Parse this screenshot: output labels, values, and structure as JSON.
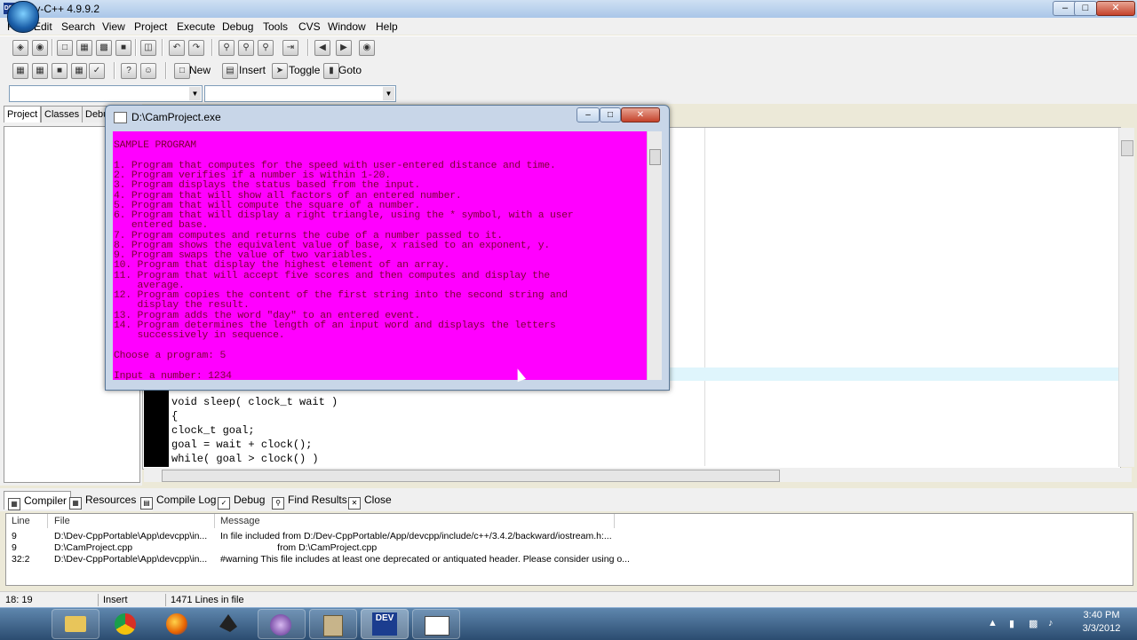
{
  "app": {
    "title": "Dev-C++ 4.9.9.2",
    "icon_label": "DEV"
  },
  "menu": [
    "File",
    "Edit",
    "Search",
    "View",
    "Project",
    "Execute",
    "Debug",
    "Tools",
    "CVS",
    "Window",
    "Help"
  ],
  "toolbar2": {
    "new_label": "New",
    "insert_label": "Insert",
    "toggle_label": "Toggle",
    "goto_label": "Goto"
  },
  "left_tabs": [
    "Project",
    "Classes",
    "Debu"
  ],
  "console": {
    "title": "D:\\CamProject.exe",
    "lines": [
      "SAMPLE PROGRAM",
      "",
      "1. Program that computes for the speed with user-entered distance and time.",
      "2. Program verifies if a number is within 1-20.",
      "3. Program displays the status based from the input.",
      "4. Program that will show all factors of an entered number.",
      "5. Program that will compute the square of a number.",
      "6. Program that will display a right triangle, using the * symbol, with a user",
      "   entered base.",
      "7. Program computes and returns the cube of a number passed to it.",
      "8. Program shows the equivalent value of base, x raised to an exponent, y.",
      "9. Program swaps the value of two variables.",
      "10. Program that display the highest element of an array.",
      "11. Program that will accept five scores and then computes and display the",
      "    average.",
      "12. Program copies the content of the first string into the second string and",
      "    display the result.",
      "13. Program adds the word \"day\" to an entered event.",
      "14. Program determines the length of an input word and displays the letters",
      "    successively in sequence.",
      "",
      "Choose a program: 5",
      "",
      "Input a number: 1234"
    ]
  },
  "code_lines": [
    "void sleep( clock_t wait )",
    "{",
    "clock_t goal;",
    "goal = wait + clock();",
    "while( goal > clock() )"
  ],
  "bottom_tabs": [
    "Compiler",
    "Resources",
    "Compile Log",
    "Debug",
    "Find Results",
    "Close"
  ],
  "compiler": {
    "headers": [
      "Line",
      "File",
      "Message"
    ],
    "rows": [
      {
        "line": "9",
        "file": "D:\\Dev-CppPortable\\App\\devcpp\\in...",
        "message": "In file included from D:/Dev-CppPortable/App/devcpp/include/c++/3.4.2/backward/iostream.h:..."
      },
      {
        "line": "9",
        "file": "D:\\CamProject.cpp",
        "message": "                      from D:\\CamProject.cpp"
      },
      {
        "line": "32:2",
        "file": "D:\\Dev-CppPortable\\App\\devcpp\\in...",
        "message": "#warning This file includes at least one deprecated or antiquated header. Please consider using o..."
      }
    ]
  },
  "status": {
    "position": "18: 19",
    "mode": "Insert",
    "lines": "1471 Lines in file"
  },
  "taskbar": {
    "time": "3:40 PM",
    "date": "3/3/2012",
    "items": [
      "explorer",
      "chrome",
      "firefox",
      "inkscape",
      "browser",
      "tool",
      "dev-cpp",
      "console"
    ]
  }
}
